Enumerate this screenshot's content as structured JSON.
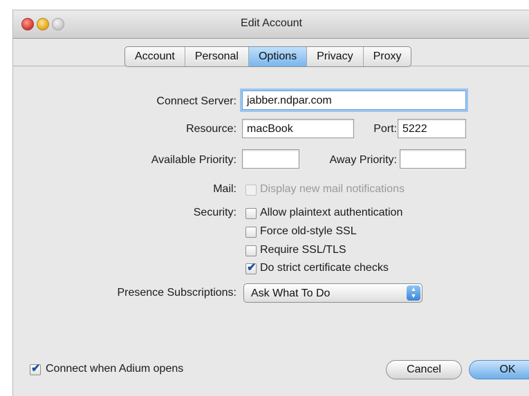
{
  "window": {
    "title": "Edit Account"
  },
  "tabs": [
    "Account",
    "Personal",
    "Options",
    "Privacy",
    "Proxy"
  ],
  "form": {
    "connect_server_label": "Connect Server:",
    "connect_server_value": "jabber.ndpar.com",
    "resource_label": "Resource:",
    "resource_value": "macBook",
    "port_label": "Port:",
    "port_value": "5222",
    "available_priority_label": "Available Priority:",
    "available_priority_value": "",
    "away_priority_label": "Away Priority:",
    "away_priority_value": "",
    "mail_label": "Mail:",
    "mail_option": {
      "label": "Display new mail notifications",
      "checked": false,
      "enabled": false
    },
    "security_label": "Security:",
    "security_options": [
      {
        "label": "Allow plaintext authentication",
        "checked": false
      },
      {
        "label": "Force old-style SSL",
        "checked": false
      },
      {
        "label": "Require SSL/TLS",
        "checked": false
      },
      {
        "label": "Do strict certificate checks",
        "checked": true
      }
    ],
    "presence_label": "Presence Subscriptions:",
    "presence_value": "Ask What To Do"
  },
  "footer": {
    "connect_label": "Connect when Adium opens",
    "connect_checked": true,
    "cancel_label": "Cancel",
    "ok_label": "OK"
  }
}
